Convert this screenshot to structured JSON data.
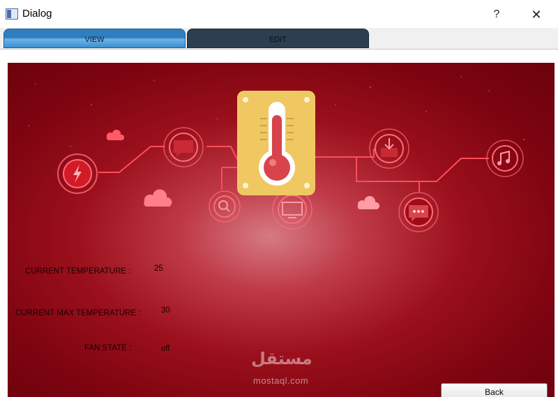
{
  "window": {
    "title": "Dialog",
    "help_glyph": "?",
    "close_glyph": "✕"
  },
  "tabs": [
    {
      "label": "VIEW",
      "active": true
    },
    {
      "label": "EDIT",
      "active": false
    }
  ],
  "fields": {
    "current_temperature": {
      "label": "CURRENT TEMPERATURE :",
      "value": "25"
    },
    "current_max_temperature": {
      "label": "CURRENT MAX TEMPERATURE :",
      "value": "30"
    },
    "fan_state": {
      "label": "FAN STATE :",
      "value": "off"
    }
  },
  "buttons": {
    "back": "Back"
  },
  "watermark": {
    "arabic": "مستقل",
    "latin": "mostaql.com"
  },
  "colors": {
    "tab_active": "#2e7fc0",
    "tab_inactive": "#2b3f50",
    "panel": "#8e0a16",
    "thermo_plate": "#f0c862",
    "thermo_liquid": "#d9434b"
  }
}
